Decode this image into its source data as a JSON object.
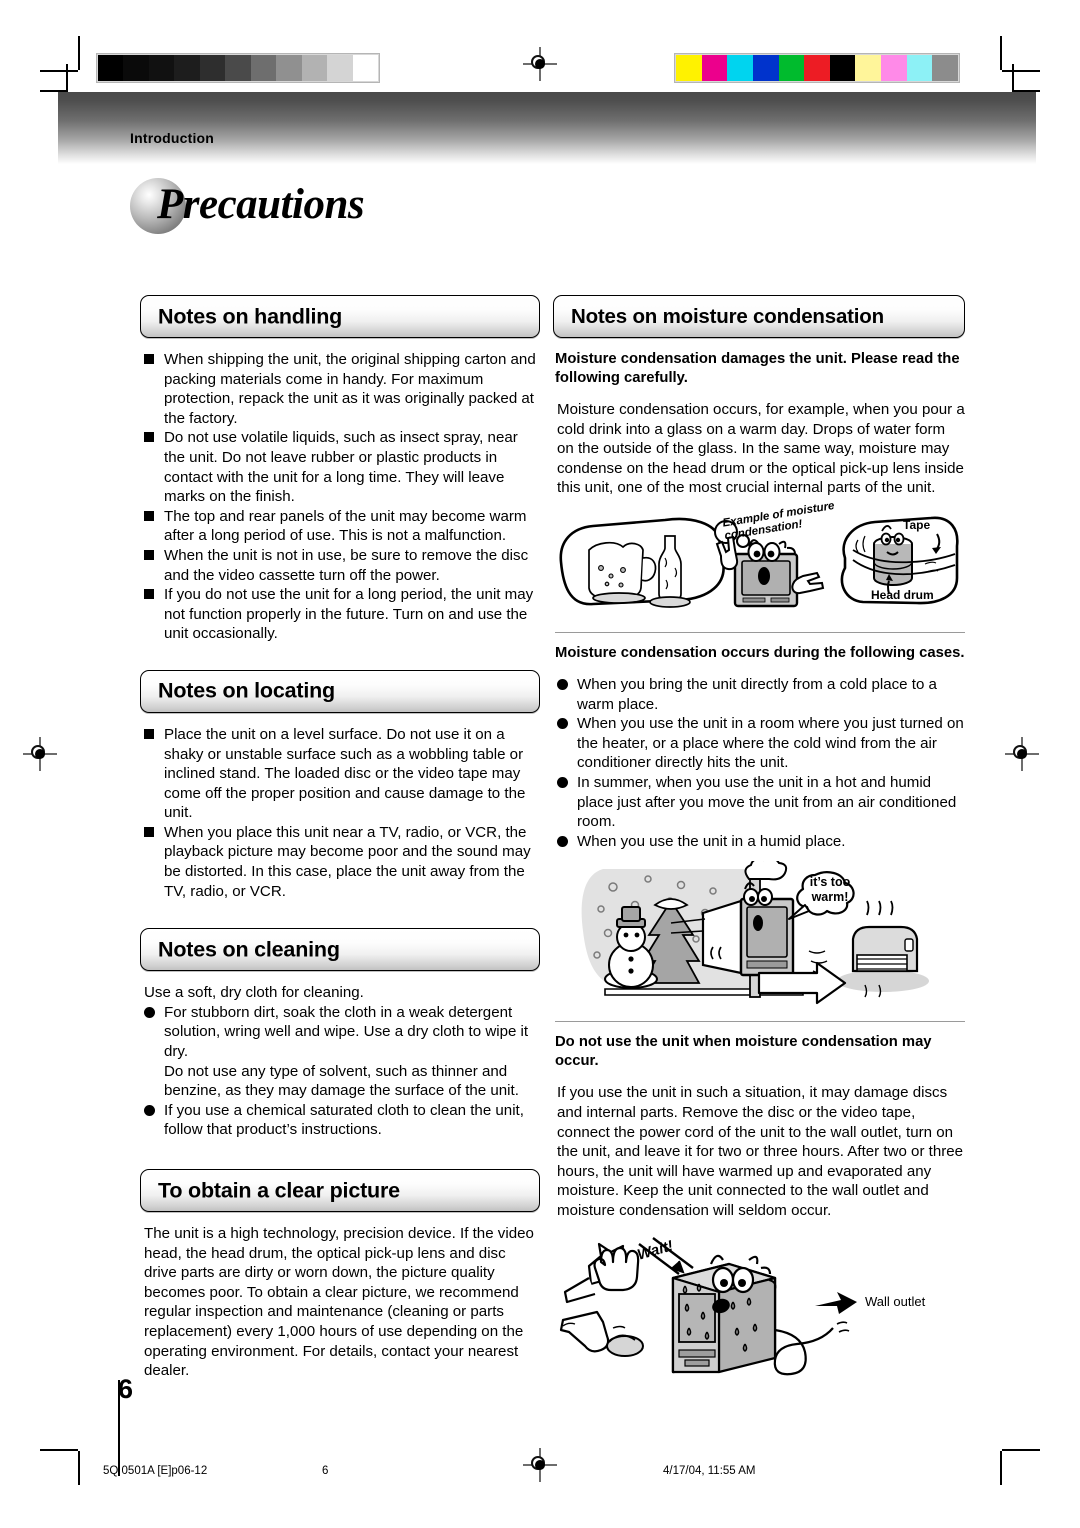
{
  "header": {
    "band_label": "Introduction",
    "page_title": "Precautions"
  },
  "calibration": {
    "grayscale": [
      "#000000",
      "#0a0a0a",
      "#111111",
      "#1d1d1d",
      "#2e2e2e",
      "#4a4a4a",
      "#6e6e6e",
      "#909090",
      "#b2b2b2",
      "#d4d4d4",
      "#ffffff"
    ],
    "colors": [
      "#fff200",
      "#ec008c",
      "#00d4ef",
      "#0033cc",
      "#00bb2d",
      "#ed1c24",
      "#000000",
      "#fff59a",
      "#ff8ae8",
      "#8df1f6",
      "#8c8c8c"
    ]
  },
  "left_column": {
    "sections": [
      {
        "title": "Notes on handling",
        "items": [
          "When shipping the unit, the original shipping carton and packing materials come in handy. For maximum protection, repack the unit as it was originally packed at the factory.",
          "Do not use volatile liquids, such as insect spray, near the unit. Do not leave rubber or plastic products in contact with the unit for a long time. They will leave marks on the finish.",
          "The top and rear panels of the unit may become warm after a long period of use. This is not a malfunction.",
          "When the unit is not in use, be sure to remove the disc and the video cassette turn off the power.",
          "If you do not use the unit for a long period, the unit may not function properly in the future. Turn on and use the unit occasionally."
        ]
      },
      {
        "title": "Notes on locating",
        "items": [
          "Place the unit on a level surface. Do not use it on a shaky or unstable surface such as a wobbling table or inclined stand. The loaded disc or the video tape may come off the proper position and cause damage to the unit.",
          "When you place this unit near a TV, radio, or VCR, the playback picture may become poor and the sound may be distorted. In this case, place the unit away from the TV, radio, or VCR."
        ]
      },
      {
        "title": "Notes on cleaning",
        "intro": "Use a soft, dry cloth for cleaning.",
        "bullets": [
          "For stubborn dirt, soak the cloth in a weak detergent solution, wring well and wipe. Use a dry cloth to wipe it dry.",
          "If you use a chemical saturated cloth to clean the unit, follow that product’s instructions."
        ],
        "nested_note": "Do not use any type of solvent, such as thinner and benzine, as they may damage the surface of the unit."
      },
      {
        "title": "To obtain a clear picture",
        "paragraph": "The unit is a high technology, precision device. If the video head, the head drum, the optical pick-up lens and disc drive parts are dirty or worn down, the picture quality becomes poor. To obtain a clear picture, we recommend regular inspection and maintenance (cleaning or parts replacement) every 1,000 hours of use depending on the operating environment. For details, contact your nearest dealer."
      }
    ]
  },
  "right_column": {
    "section_title": "Notes on moisture condensation",
    "lead_bold": "Moisture condensation damages the unit. Please read the following carefully.",
    "paragraph_1": "Moisture condensation occurs, for example, when you pour a cold drink into a glass on a warm day. Drops of water form on the outside of the glass. In the same way, moisture may condense on the head drum or the optical pick-up lens inside this unit, one of the most crucial internal parts of the unit.",
    "figure_1": {
      "caption": "Example of moisture condensation!",
      "label_tape": "Tape",
      "label_head_drum": "Head drum"
    },
    "cases_heading": "Moisture condensation occurs during the following cases.",
    "cases": [
      "When you bring the unit directly from a cold place to a warm place.",
      "When you use the unit in a room where you just turned on the heater, or a place where the cold wind from the air conditioner directly hits the unit.",
      "In summer, when you use the unit in a hot and humid place just after you move the unit from an air conditioned room.",
      "When you use the unit in a humid place."
    ],
    "figure_2": {
      "speech": "it’s too\nwarm!"
    },
    "warning_heading": "Do not use the unit when moisture condensation may occur.",
    "warning_paragraph": "If you use the unit in such a situation, it may damage discs and internal parts. Remove the disc or the video tape, connect the power cord of the unit to the wall outlet, turn on the unit, and leave it for two or three hours. After two or three hours, the unit will have warmed up and evaporated any moisture. Keep the unit connected to the wall outlet and moisture condensation will seldom occur.",
    "figure_3": {
      "speech": "Wait!",
      "label_wall_outlet": "Wall outlet"
    }
  },
  "footer": {
    "page_number": "6",
    "file_ref": "5Q 0501A [E]p06-12",
    "footer_page": "6",
    "timestamp": "4/17/04, 11:55 AM"
  }
}
